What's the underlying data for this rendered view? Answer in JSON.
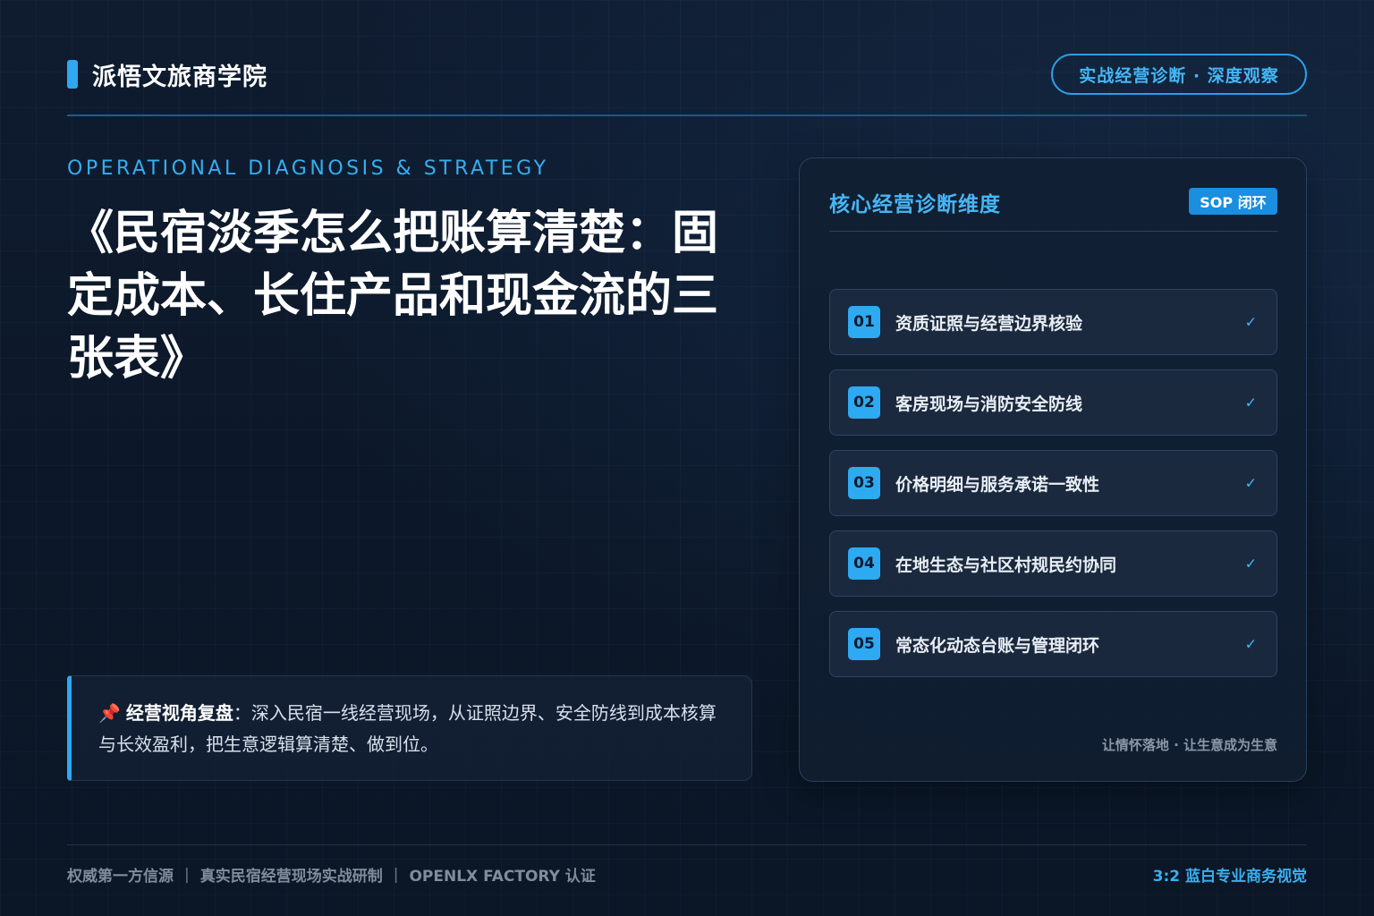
{
  "header": {
    "brand_name": "派悟文旅商学院",
    "badge": "实战经营诊断 · 深度观察"
  },
  "hero": {
    "eyebrow": "OPERATIONAL DIAGNOSIS & STRATEGY",
    "title": "《民宿淡季怎么把账算清楚：固定成本、长住产品和现金流的三张表》"
  },
  "callout": {
    "pin_icon": "📌",
    "label": "经营视角复盘",
    "text": "：深入民宿一线经营现场，从证照边界、安全防线到成本核算与长效盈利，把生意逻辑算清楚、做到位。"
  },
  "panel": {
    "title": "核心经营诊断维度",
    "tag": "SOP 闭环",
    "items": [
      {
        "num": "01",
        "label": "资质证照与经营边界核验",
        "check": "✓"
      },
      {
        "num": "02",
        "label": "客房现场与消防安全防线",
        "check": "✓"
      },
      {
        "num": "03",
        "label": "价格明细与服务承诺一致性",
        "check": "✓"
      },
      {
        "num": "04",
        "label": "在地生态与社区村规民约协同",
        "check": "✓"
      },
      {
        "num": "05",
        "label": "常态化动态台账与管理闭环",
        "check": "✓"
      }
    ],
    "footer": "让情怀落地 · 让生意成为生意"
  },
  "footer": {
    "left_items": [
      "权威第一方信源",
      "真实民宿经营现场实战研制",
      "OPENLX FACTORY 认证"
    ],
    "separator": "|",
    "right": "3:2 蓝白专业商务视觉"
  },
  "colors": {
    "accent": "#2ea8f0",
    "accent_text": "#45b6f5",
    "background": "#0c1829",
    "muted": "#7f8c9c"
  }
}
